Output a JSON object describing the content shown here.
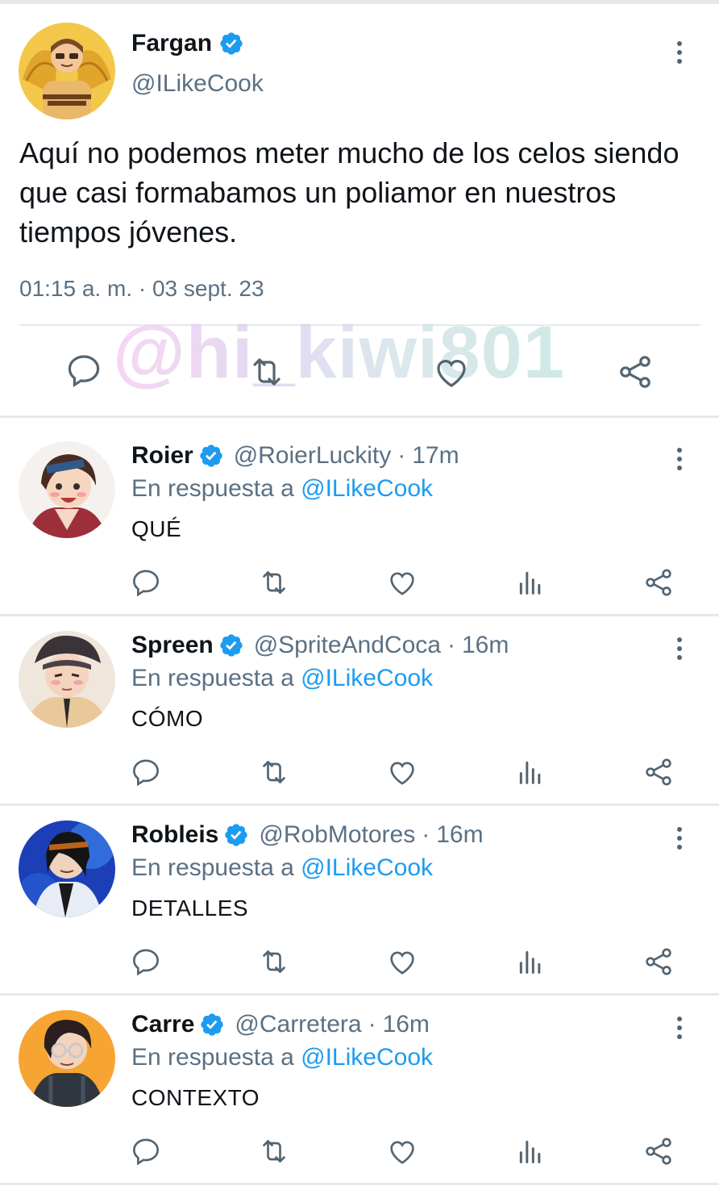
{
  "main_tweet": {
    "name": "Fargan",
    "handle": "@ILikeCook",
    "text": "Aquí no podemos meter mucho de los celos siendo que casi formabamos un poliamor en nuestros tiempos jóvenes.",
    "timestamp": "01:15 a. m. · 03 sept. 23",
    "verified": true,
    "actions": [
      "reply-icon",
      "retweet-icon",
      "like-icon",
      "share-icon"
    ]
  },
  "watermark": "@hi_kiwi801",
  "reply_prefix": "En respuesta a",
  "replies": [
    {
      "name": "Roier",
      "handle": "@RoierLuckity",
      "time": "17m",
      "mention": "@ILikeCook",
      "text": "QUÉ"
    },
    {
      "name": "Spreen",
      "handle": "@SpriteAndCoca",
      "time": "16m",
      "mention": "@ILikeCook",
      "text": "CÓMO"
    },
    {
      "name": "Robleis",
      "handle": "@RobMotores",
      "time": "16m",
      "mention": "@ILikeCook",
      "text": "DETALLES"
    },
    {
      "name": "Carre",
      "handle": "@Carretera",
      "time": "16m",
      "mention": "@ILikeCook",
      "text": "CONTEXTO"
    }
  ],
  "reply_actions": [
    "reply-icon",
    "retweet-icon",
    "like-icon",
    "views-icon",
    "share-icon"
  ],
  "colors": {
    "accent": "#1d9bf0",
    "secondary_text": "#5b7083",
    "primary_text": "#0f1419",
    "divider": "#e6e9ec"
  }
}
